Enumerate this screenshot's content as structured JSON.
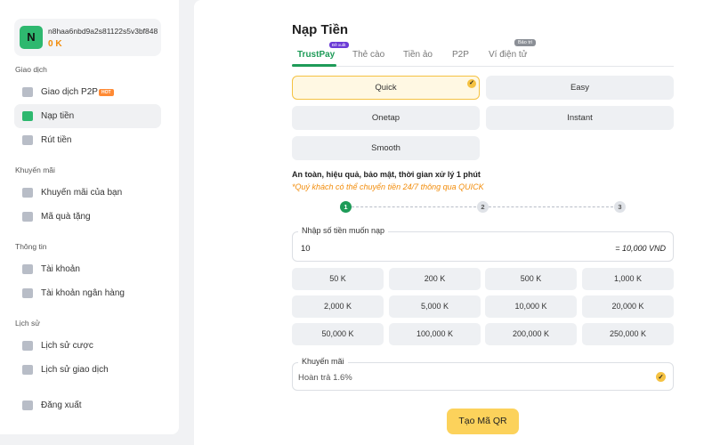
{
  "user": {
    "avatar_letter": "N",
    "name": "n8haa6nbd9a2s81122s5v3bf848...",
    "balance": "0 K"
  },
  "sidebar": {
    "sections": [
      {
        "title": "Giao dịch"
      },
      {
        "title": "Khuyến mãi"
      },
      {
        "title": "Thông tin"
      },
      {
        "title": "Lịch sử"
      }
    ],
    "items": [
      {
        "label": "Giao dịch P2P",
        "badge": "HOT",
        "icon": "exchange-icon"
      },
      {
        "label": "Nạp tiền",
        "icon": "wallet-icon",
        "active": true
      },
      {
        "label": "Rút tiền",
        "icon": "withdraw-icon"
      },
      {
        "label": "Khuyến mãi của bạn",
        "icon": "promo-icon"
      },
      {
        "label": "Mã quà tặng",
        "icon": "gift-icon"
      },
      {
        "label": "Tài khoản",
        "icon": "user-icon"
      },
      {
        "label": "Tài khoản ngân hàng",
        "icon": "bank-icon"
      },
      {
        "label": "Lịch sử cược",
        "icon": "bet-history-icon"
      },
      {
        "label": "Lịch sử giao dịch",
        "icon": "transaction-history-icon"
      },
      {
        "label": "Đăng xuất",
        "icon": "logout-icon"
      }
    ]
  },
  "main": {
    "title": "Nạp Tiền",
    "tabs": [
      {
        "label": "TrustPay",
        "badge": "Đề xuất",
        "active": true
      },
      {
        "label": "Thẻ cào"
      },
      {
        "label": "Tiền ảo"
      },
      {
        "label": "P2P"
      },
      {
        "label": "Ví điện tử",
        "badge": "Bảo trì"
      }
    ],
    "methods": [
      {
        "label": "Quick",
        "selected": true
      },
      {
        "label": "Easy"
      },
      {
        "label": "Onetap"
      },
      {
        "label": "Instant"
      },
      {
        "label": "Smooth"
      }
    ],
    "info_line": "An toàn, hiệu quả, bảo mật, thời gian xử lý 1 phút",
    "notice_line": "*Quý khách có thể chuyển tiền 24/7 thông qua QUICK",
    "steps": [
      "1",
      "2",
      "3"
    ],
    "amount": {
      "label": "Nhập số tiền muốn nạp",
      "value": "10",
      "converted": "= 10,000 VND"
    },
    "amount_options": [
      "50 K",
      "200 K",
      "500 K",
      "1,000 K",
      "2,000 K",
      "5,000 K",
      "10,000 K",
      "20,000 K",
      "50,000 K",
      "100,000 K",
      "200,000 K",
      "250,000 K"
    ],
    "promo": {
      "label": "Khuyến mãi",
      "value": "Hoàn trả 1.6%"
    },
    "submit_label": "Tạo Mã QR"
  },
  "colors": {
    "accent_green": "#1e9b58",
    "accent_yellow": "#fcd25b",
    "orange": "#f28c0a"
  }
}
